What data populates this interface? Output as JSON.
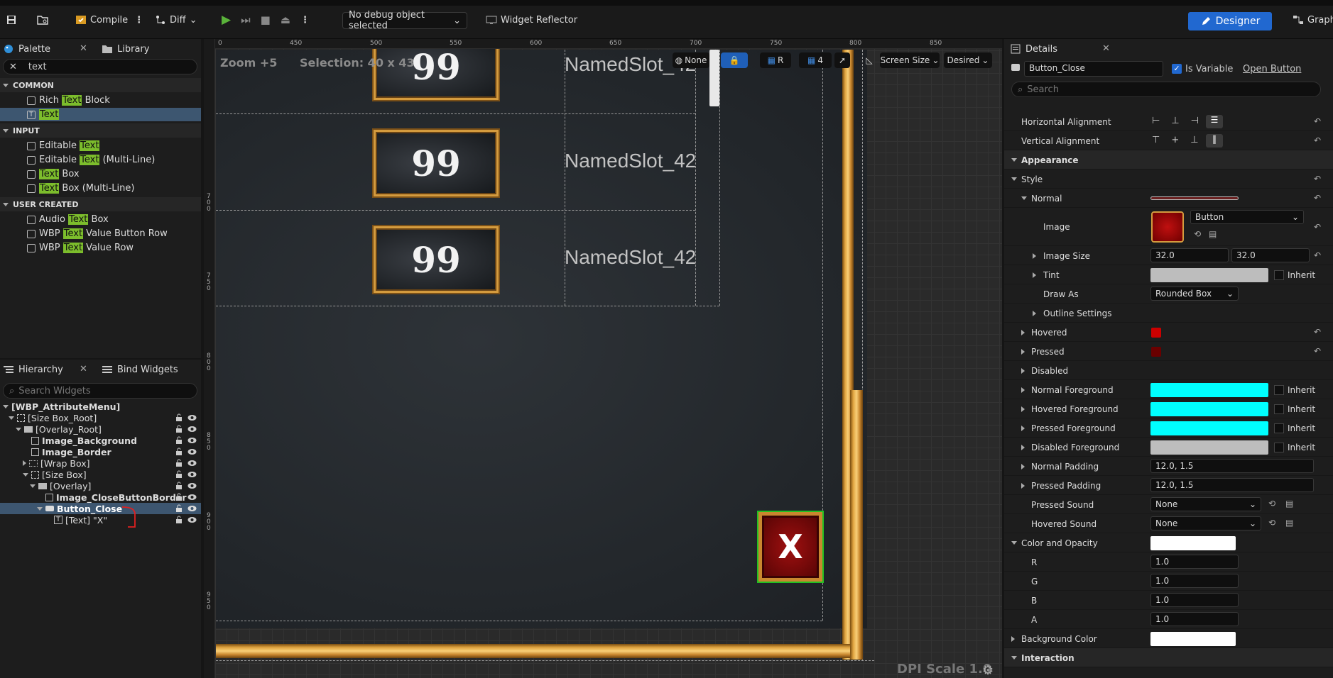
{
  "toolbar": {
    "compile_label": "Compile",
    "diff_label": "Diff",
    "debug_object": "No debug object selected",
    "widget_reflector": "Widget Reflector",
    "designer_label": "Designer",
    "graph_label": "Graph"
  },
  "palette": {
    "tab_label": "Palette",
    "library_label": "Library",
    "search_value": "text",
    "categories": [
      {
        "name": "COMMON",
        "items": [
          {
            "pre": "Rich ",
            "hl": "Text",
            "post": " Block"
          },
          {
            "pre": "",
            "hl": "Text",
            "post": ""
          }
        ]
      },
      {
        "name": "INPUT",
        "items": [
          {
            "pre": "Editable ",
            "hl": "Text",
            "post": ""
          },
          {
            "pre": "Editable ",
            "hl": "Text",
            "post": " (Multi-Line)"
          },
          {
            "pre": "",
            "hl": "Text",
            "post": " Box"
          },
          {
            "pre": "",
            "hl": "Text",
            "post": " Box (Multi-Line)"
          }
        ]
      },
      {
        "name": "USER CREATED",
        "items": [
          {
            "pre": "Audio ",
            "hl": "Text",
            "post": " Box"
          },
          {
            "pre": "WBP ",
            "hl": "Text",
            "post": " Value Button Row"
          },
          {
            "pre": "WBP ",
            "hl": "Text",
            "post": " Value Row"
          }
        ]
      }
    ]
  },
  "hierarchy": {
    "tab_label": "Hierarchy",
    "bind_label": "Bind Widgets",
    "search_placeholder": "Search Widgets",
    "rows": [
      "[WBP_AttributeMenu]",
      "[Size Box_Root]",
      "[Overlay_Root]",
      "Image_Background",
      "Image_Border",
      "[Wrap Box]",
      "[Size Box]",
      "[Overlay]",
      "Image_CloseButtonBorder",
      "Button_Close",
      "[Text] \"X\""
    ]
  },
  "canvas": {
    "zoom_text": "Zoom +5",
    "selection_text": "Selection: 40 x 43",
    "dpi_text": "DPI Scale 1.0",
    "slot_value": "99",
    "slot_label": "NamedSlot_42",
    "close_label": "X",
    "ruler_top": [
      "0",
      "450",
      "500",
      "550",
      "600",
      "650",
      "700",
      "750",
      "800",
      "850"
    ],
    "ruler_left": [
      "7\n0\n0",
      "7\n5\n0",
      "8\n0\n0",
      "8\n5\n0",
      "9\n0\n0",
      "9\n5\n0"
    ],
    "ctrl_none": "None",
    "ctrl_r": "R",
    "ctrl_4": "4",
    "screen_size": "Screen Size",
    "desired": "Desired"
  },
  "details": {
    "tab_label": "Details",
    "widget_name": "Button_Close",
    "is_variable_label": "Is Variable",
    "open_button_label": "Open Button",
    "search_placeholder": "Search",
    "rows": {
      "horizontal_alignment": "Horizontal Alignment",
      "vertical_alignment": "Vertical Alignment",
      "appearance": "Appearance",
      "style": "Style",
      "normal": "Normal",
      "image": "Image",
      "image_resource": "Button",
      "image_size": "Image Size",
      "image_size_x": "32.0",
      "image_size_y": "32.0",
      "tint": "Tint",
      "inherit": "Inherit",
      "draw_as": "Draw As",
      "draw_as_value": "Rounded Box",
      "outline_settings": "Outline Settings",
      "hovered": "Hovered",
      "pressed": "Pressed",
      "disabled": "Disabled",
      "normal_fg": "Normal Foreground",
      "hovered_fg": "Hovered Foreground",
      "pressed_fg": "Pressed Foreground",
      "disabled_fg": "Disabled Foreground",
      "normal_padding": "Normal Padding",
      "normal_padding_value": "12.0, 1.5",
      "pressed_padding": "Pressed Padding",
      "pressed_padding_value": "12.0, 1.5",
      "pressed_sound": "Pressed Sound",
      "pressed_sound_value": "None",
      "hovered_sound": "Hovered Sound",
      "hovered_sound_value": "None",
      "color_opacity": "Color and Opacity",
      "r": "R",
      "r_value": "1.0",
      "g": "G",
      "g_value": "1.0",
      "b": "B",
      "b_value": "1.0",
      "a": "A",
      "a_value": "1.0",
      "background_color": "Background Color",
      "interaction": "Interaction"
    }
  },
  "colors": {
    "accent": "#2168d0",
    "highlight": "#7cbd2c",
    "cyan": "#00ffff",
    "dark_red": "#8b0000",
    "gold": "#d49b3e"
  }
}
